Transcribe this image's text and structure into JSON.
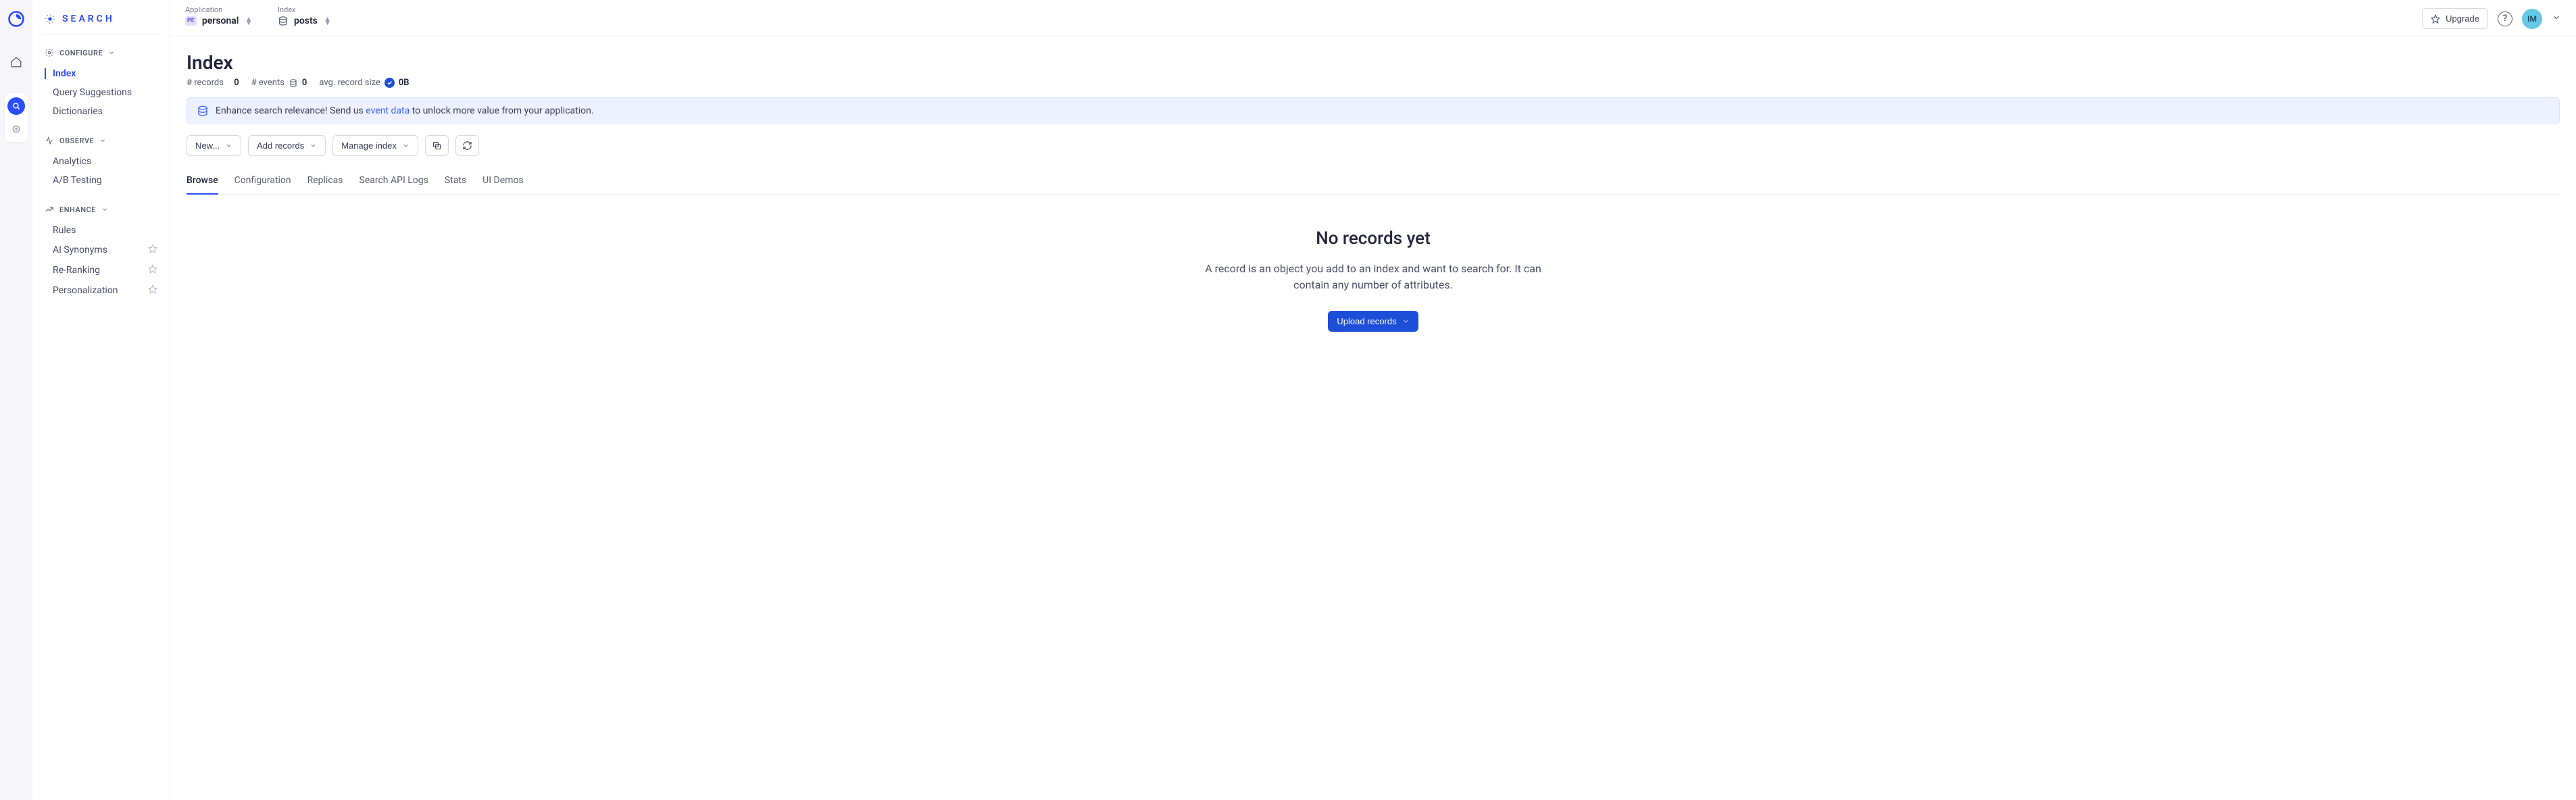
{
  "rail": {
    "search_tooltip": "Search"
  },
  "sidebar": {
    "title": "SEARCH",
    "sections": [
      {
        "label": "CONFIGURE",
        "items": [
          {
            "label": "Index",
            "active": true
          },
          {
            "label": "Query Suggestions"
          },
          {
            "label": "Dictionaries"
          }
        ]
      },
      {
        "label": "OBSERVE",
        "items": [
          {
            "label": "Analytics"
          },
          {
            "label": "A/B Testing"
          }
        ]
      },
      {
        "label": "ENHANCE",
        "items": [
          {
            "label": "Rules"
          },
          {
            "label": "AI Synonyms",
            "starred": true
          },
          {
            "label": "Re-Ranking",
            "starred": true
          },
          {
            "label": "Personalization",
            "starred": true
          }
        ]
      }
    ]
  },
  "topbar": {
    "application_label": "Application",
    "application_value": "personal",
    "application_badge": "PE",
    "index_label": "Index",
    "index_value": "posts",
    "upgrade_label": "Upgrade",
    "avatar_initials": "IM"
  },
  "page": {
    "title": "Index",
    "stats": {
      "records_label": "# records",
      "records_value": "0",
      "events_label": "# events",
      "events_value": "0",
      "avg_label": "avg. record size",
      "avg_value": "0B"
    },
    "banner": {
      "prefix": "Enhance search relevance! Send us ",
      "link": "event data",
      "suffix": " to unlock more value from your application."
    },
    "actions": {
      "new_label": "New...",
      "add_records_label": "Add records",
      "manage_index_label": "Manage index"
    },
    "tabs": [
      {
        "label": "Browse",
        "active": true
      },
      {
        "label": "Configuration"
      },
      {
        "label": "Replicas"
      },
      {
        "label": "Search API Logs"
      },
      {
        "label": "Stats"
      },
      {
        "label": "UI Demos"
      }
    ],
    "empty": {
      "heading": "No records yet",
      "body": "A record is an object you add to an index and want to search for. It can contain any number of attributes.",
      "cta": "Upload records"
    }
  }
}
